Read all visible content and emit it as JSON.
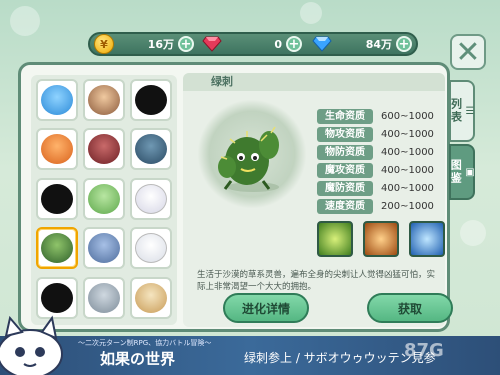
{
  "currencies": [
    {
      "name": "gold",
      "value": "16万",
      "color": "#f0a900"
    },
    {
      "name": "ruby",
      "value": "0",
      "color": "#e43a5a"
    },
    {
      "name": "diamond",
      "value": "84万",
      "color": "#3aa4ff"
    }
  ],
  "detail": {
    "name": "绿刺",
    "stats": [
      {
        "label": "生命资质",
        "value": "600~1000"
      },
      {
        "label": "物攻资质",
        "value": "400~1000"
      },
      {
        "label": "物防资质",
        "value": "400~1000"
      },
      {
        "label": "魔攻资质",
        "value": "400~1000"
      },
      {
        "label": "魔防资质",
        "value": "400~1000"
      },
      {
        "label": "速度资质",
        "value": "200~1000"
      }
    ],
    "description": "生活于沙漠的草系灵兽，遍布全身的尖刺让人觉得凶猛可怕，实际上非常渴望一个大大的拥抱。",
    "evolve_label": "进化详情",
    "obtain_label": "获取"
  },
  "tabs": {
    "list": "列表",
    "book": "图鉴"
  },
  "banner": {
    "small": "～二次元ターン制RPG、協力バトル冒険～",
    "title": "如果の世界",
    "subtitle": "绿刺参上 / サボオウゥウッテン見参"
  },
  "watermark": "87G",
  "close_icon": "close-icon"
}
